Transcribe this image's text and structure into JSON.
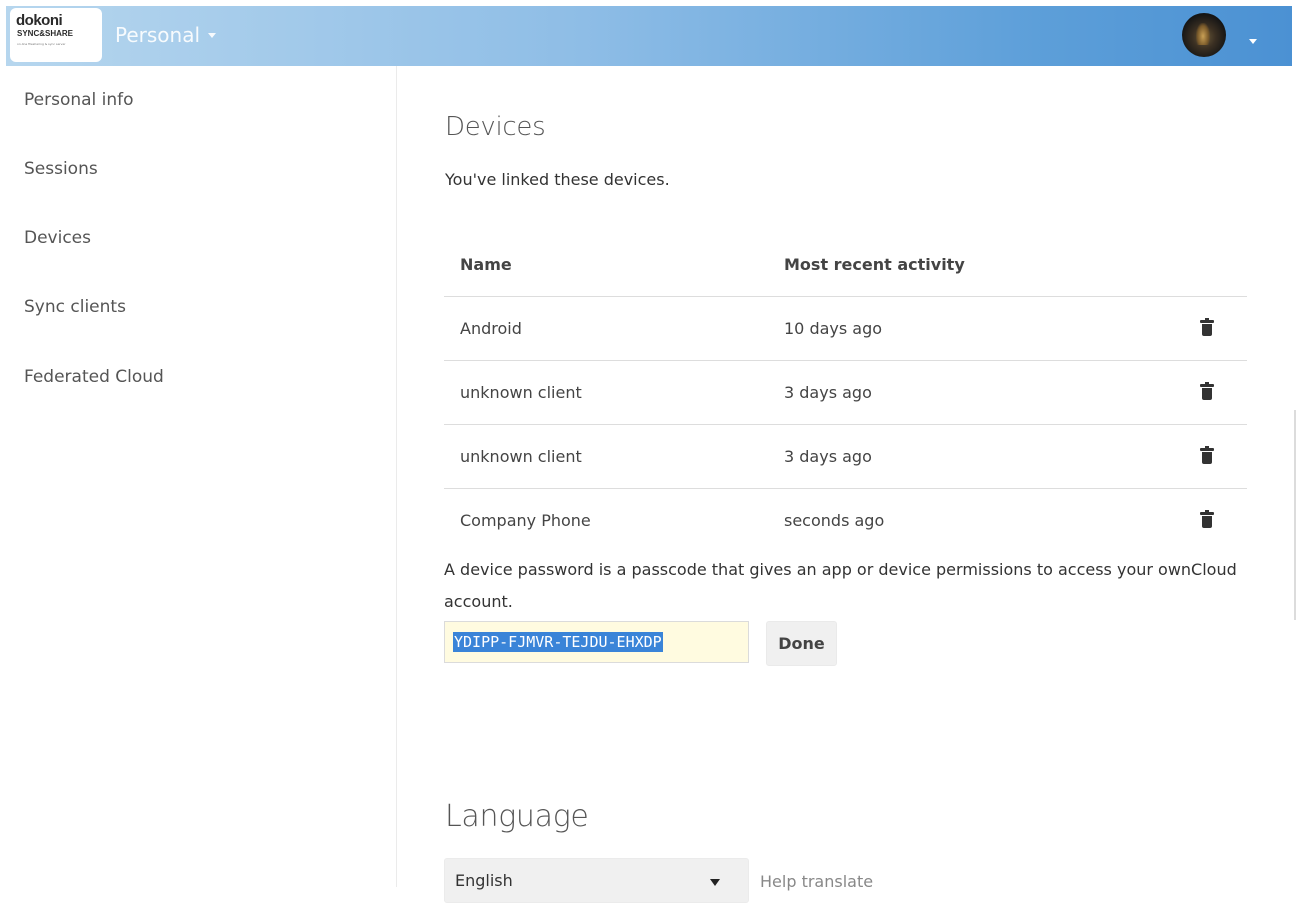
{
  "header": {
    "logo_main": "dokoni",
    "logo_sub": "SYNC&SHARE",
    "logo_tagline": "on-line filesharing & sync server",
    "app_name": "Personal",
    "gradient_colors": [
      "#b6d6ee",
      "#4b91d3"
    ]
  },
  "sidebar": {
    "items": [
      {
        "label": "Personal info"
      },
      {
        "label": "Sessions"
      },
      {
        "label": "Devices"
      },
      {
        "label": "Sync clients"
      },
      {
        "label": "Federated Cloud"
      }
    ]
  },
  "devices": {
    "title": "Devices",
    "subtitle": "You've linked these devices.",
    "columns": [
      "Name",
      "Most recent activity"
    ],
    "rows": [
      {
        "name": "Android",
        "activity": "10 days ago",
        "action_icon": "trash-icon"
      },
      {
        "name": "unknown client",
        "activity": "3 days ago",
        "action_icon": "trash-icon"
      },
      {
        "name": "unknown client",
        "activity": "3 days ago",
        "action_icon": "trash-icon"
      },
      {
        "name": "Company Phone",
        "activity": "seconds ago",
        "action_icon": "trash-icon"
      }
    ],
    "password_description": "A device password is a passcode that gives an app or device permissions to access your ownCloud account.",
    "generated_password": "YDIPP-FJMVR-TEJDU-EHXDP",
    "done_label": "Done"
  },
  "language": {
    "title": "Language",
    "selected": "English",
    "help_translate": "Help translate"
  }
}
